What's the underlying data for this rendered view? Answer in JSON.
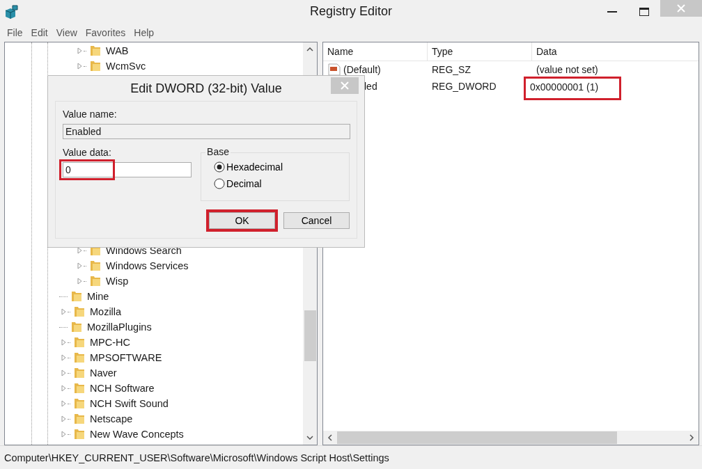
{
  "window": {
    "title": "Registry Editor"
  },
  "menu": [
    "File",
    "Edit",
    "View",
    "Favorites",
    "Help"
  ],
  "tree": {
    "nested_items": [
      {
        "label": "WAB",
        "has_children": true
      },
      {
        "label": "WcmSvc",
        "has_children": true
      },
      {
        "label": "Windows Search",
        "has_children": true
      },
      {
        "label": "Windows Services",
        "has_children": true
      },
      {
        "label": "Wisp",
        "has_children": true
      }
    ],
    "items": [
      {
        "label": "Mine",
        "has_children": false
      },
      {
        "label": "Mozilla",
        "has_children": true
      },
      {
        "label": "MozillaPlugins",
        "has_children": false
      },
      {
        "label": "MPC-HC",
        "has_children": true
      },
      {
        "label": "MPSOFTWARE",
        "has_children": true
      },
      {
        "label": "Naver",
        "has_children": true
      },
      {
        "label": "NCH Software",
        "has_children": true
      },
      {
        "label": "NCH Swift Sound",
        "has_children": true
      },
      {
        "label": "Netscape",
        "has_children": true
      },
      {
        "label": "New Wave Concepts",
        "has_children": true
      }
    ]
  },
  "values": {
    "columns": [
      "Name",
      "Type",
      "Data"
    ],
    "rows": [
      {
        "kind": "string",
        "name": "(Default)",
        "type": "REG_SZ",
        "data": "(value not set)",
        "highlighted": false
      },
      {
        "kind": "dword",
        "name": "led",
        "type": "REG_DWORD",
        "data": "0x00000001 (1)",
        "highlighted": true
      }
    ]
  },
  "status_bar": "Computer\\HKEY_CURRENT_USER\\Software\\Microsoft\\Windows Script Host\\Settings",
  "dialog": {
    "title": "Edit DWORD (32-bit) Value",
    "value_name_label": "Value name:",
    "value_name": "Enabled",
    "value_data_label": "Value data:",
    "value_data": "0",
    "value_data_highlighted": true,
    "base_label": "Base",
    "base_options": [
      {
        "label": "Hexadecimal",
        "selected": true
      },
      {
        "label": "Decimal",
        "selected": false
      }
    ],
    "buttons": [
      {
        "label": "OK",
        "highlighted": true
      },
      {
        "label": "Cancel",
        "highlighted": false
      }
    ]
  }
}
